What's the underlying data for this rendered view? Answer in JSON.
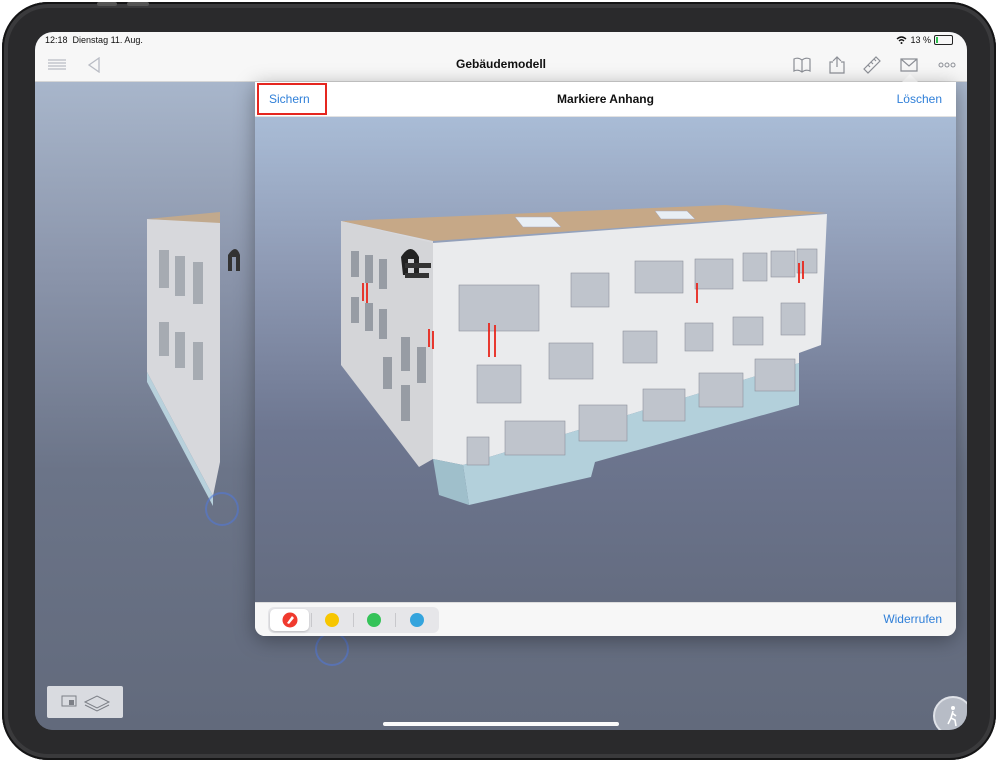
{
  "status_bar": {
    "time": "12:18",
    "date": "Dienstag 11. Aug.",
    "battery": "13 %",
    "battery_level": 0.13
  },
  "nav": {
    "title": "Gebäudemodell",
    "left_icons": [
      "list-icon",
      "back-icon"
    ],
    "right_icons": [
      "book-icon",
      "share-icon",
      "ruler-icon",
      "mail-icon",
      "more-icon"
    ]
  },
  "modal": {
    "title": "Markiere Anhang",
    "save_label": "Sichern",
    "delete_label": "Löschen",
    "undo_label": "Widerrufen",
    "colors": [
      {
        "name": "red",
        "hex": "#f03a2e",
        "selected": true
      },
      {
        "name": "yellow",
        "hex": "#f7c600",
        "selected": false
      },
      {
        "name": "green",
        "hex": "#35c359",
        "selected": false
      },
      {
        "name": "blue",
        "hex": "#34a4dd",
        "selected": false
      }
    ]
  },
  "accent_color": "#2f7fd8"
}
